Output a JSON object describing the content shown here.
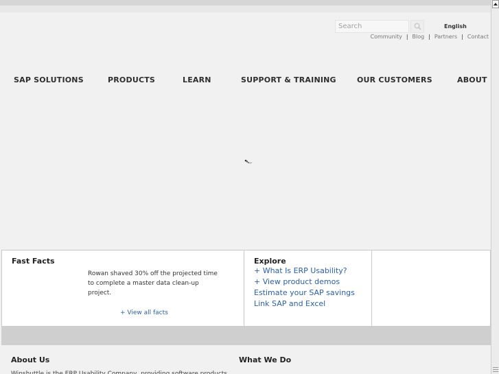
{
  "search": {
    "placeholder": "Search"
  },
  "language": "English",
  "util_links": [
    "Community",
    "Blog",
    "Partners",
    "Contact"
  ],
  "nav": [
    "SAP SOLUTIONS",
    "PRODUCTS",
    "LEARN",
    "SUPPORT & TRAINING",
    "OUR CUSTOMERS",
    "ABOUT"
  ],
  "fast_facts": {
    "title": "Fast Facts",
    "text": "Rowan shaved 30% off the projected time to complete a master data clean-up project.",
    "link": "+ View all facts"
  },
  "explore": {
    "title": "Explore",
    "links": [
      "+ What Is ERP Usability?",
      "+ View product demos",
      "Estimate your SAP savings",
      "Link SAP and Excel"
    ]
  },
  "footer": {
    "about_title": "About Us",
    "about_text": "Winshuttle is the ERP Usability Company, providing software products",
    "whatwedo_title": "What We Do"
  },
  "colors": {
    "link": "#2b5fa5",
    "nav": "#2e2e2e",
    "background": "#f1f1f1"
  }
}
